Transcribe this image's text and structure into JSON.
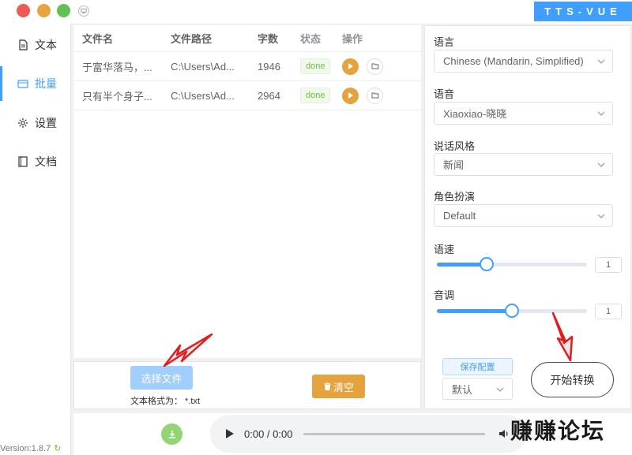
{
  "window": {
    "brand": "TTS-VUE"
  },
  "sidebar": {
    "items": [
      {
        "label": "文本",
        "icon": "document-icon",
        "active": false
      },
      {
        "label": "批量",
        "icon": "batch-icon",
        "active": true
      },
      {
        "label": "设置",
        "icon": "gear-icon",
        "active": false
      },
      {
        "label": "文档",
        "icon": "book-icon",
        "active": false
      }
    ],
    "version": "Version:1.8.7"
  },
  "table": {
    "columns": [
      "文件名",
      "文件路径",
      "字数",
      "状态",
      "操作"
    ],
    "rows": [
      {
        "name": "于富华落马，...",
        "path": "C:\\Users\\Ad...",
        "count": "1946",
        "status": "done"
      },
      {
        "name": "只有半个身子...",
        "path": "C:\\Users\\Ad...",
        "count": "2964",
        "status": "done"
      }
    ]
  },
  "actions": {
    "select_file": "选择文件",
    "format_hint": "文本格式为：   *.txt",
    "clear": "清空"
  },
  "player": {
    "time": "0:00 / 0:00"
  },
  "watermark": "赚赚论坛",
  "settings": {
    "language": {
      "label": "语言",
      "value": "Chinese (Mandarin, Simplified)"
    },
    "voice": {
      "label": "语音",
      "value": "Xiaoxiao-晓晓"
    },
    "style": {
      "label": "说话风格",
      "value": "新闻"
    },
    "role": {
      "label": "角色扮演",
      "value": "Default"
    },
    "rate": {
      "label": "语速",
      "value": "1",
      "fraction": 0.33
    },
    "pitch": {
      "label": "音调",
      "value": "1",
      "fraction": 0.5
    },
    "save_config": "保存配置",
    "config_select": "默认",
    "start": "开始转换"
  },
  "colors": {
    "primary": "#409eff",
    "warning": "#e6a23c",
    "success": "#67c23a"
  }
}
